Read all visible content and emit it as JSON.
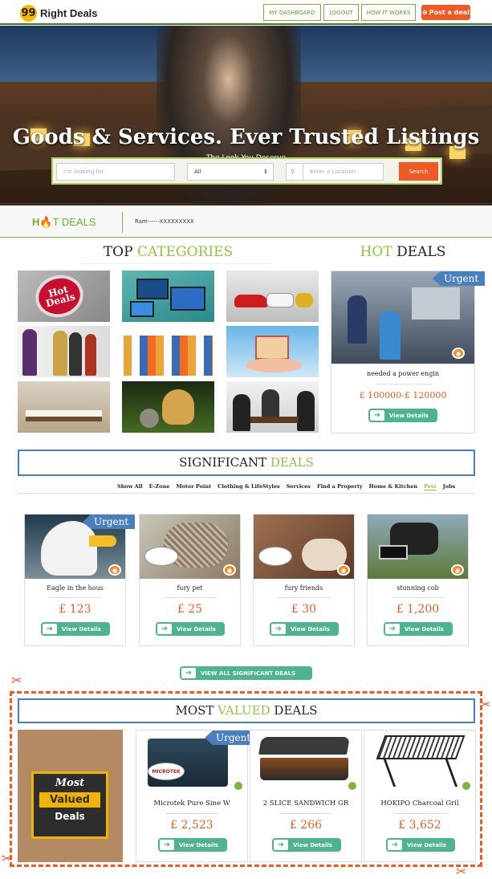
{
  "header": {
    "logo_text": "Right Deals",
    "logo_glyph": "99",
    "nav": [
      "MY DASHBOARD",
      "LOGOUT",
      "HOW IT WORKS"
    ],
    "post_label": "Post a deal",
    "accent": "#ef5a22",
    "green": "#8cc63f"
  },
  "hero": {
    "title": "Goods & Services. Ever Trusted Listings",
    "subtitle": "The Look You Deserve",
    "search_placeholder": "I'm looking for",
    "category_value": "All",
    "location_placeholder": "Enter a Location",
    "search_button": "Search"
  },
  "hotbar": {
    "logo_prefix": "H",
    "logo_suffix": "T DEALS",
    "ticker": "Ram------XXXXXXXXX"
  },
  "top_categories": {
    "title_a": "TOP",
    "title_b": "CATEGORIES",
    "tile_label": "Hot Deals"
  },
  "hot_deals": {
    "title_a": "HOT",
    "title_b": "DEALS",
    "badge": "Urgent",
    "item_title": "needed a power engin",
    "price": "£ 100000-£ 120000",
    "button": "View Details"
  },
  "significant": {
    "title_a": "SIGNIFICANT",
    "title_b": "DEALS",
    "tabs": [
      "Show All",
      "E-Zone",
      "Motor Point",
      "Clothing & LifeStyles",
      "Services",
      "Find a Property",
      "Home & Kitchen",
      "Pets",
      "Jobs"
    ],
    "active_tab": "Pets",
    "badge": "Urgent",
    "cards": [
      {
        "title": "Eagle in the hous",
        "price": "£ 123"
      },
      {
        "title": "fury pet",
        "price": "£ 25"
      },
      {
        "title": "fury friends",
        "price": "£ 30"
      },
      {
        "title": "stunning cob",
        "price": "£ 1,200"
      }
    ],
    "button": "View Details",
    "view_all": "VIEW ALL SIGNIFICANT DEALS"
  },
  "valued": {
    "title_a": "MOST",
    "title_b": "VALUED",
    "title_c": "DEALS",
    "promo": [
      "Most",
      "Valued",
      "Deals"
    ],
    "badge": "Urgent",
    "brand_logo": "MICROTEK",
    "cards": [
      {
        "title": "Microtek Pure Sine W",
        "price": "£ 2,523"
      },
      {
        "title": "2 SLICE SANDWICH GR",
        "price": "£ 266"
      },
      {
        "title": "HOKIPO Charcoal Gril",
        "price": "£ 3,652"
      }
    ],
    "button": "View Details"
  }
}
